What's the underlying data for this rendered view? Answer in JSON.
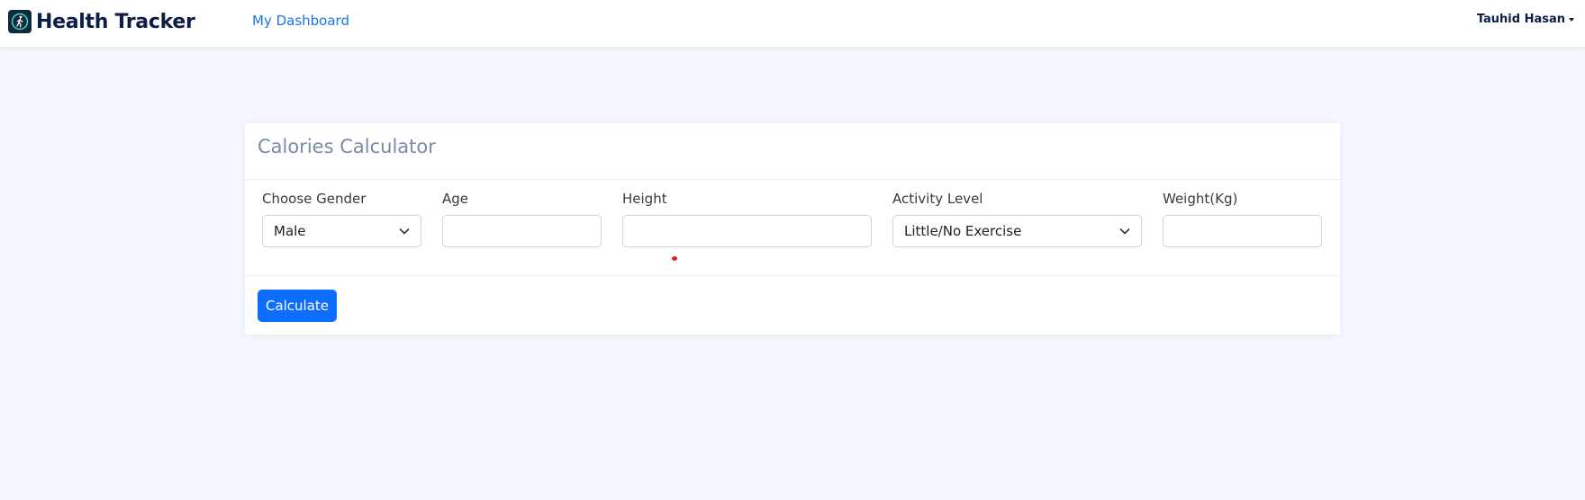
{
  "navbar": {
    "brand": "Health Tracker",
    "brand_icon": "walking-person-icon",
    "link": "My Dashboard",
    "user": "Tauhid Hasan"
  },
  "calculator": {
    "title": "Calories Calculator",
    "gender": {
      "label": "Choose Gender",
      "value": "Male"
    },
    "age": {
      "label": "Age",
      "value": "",
      "placeholder": ""
    },
    "height": {
      "label": "Height",
      "value": "",
      "placeholder": ""
    },
    "activity": {
      "label": "Activity Level",
      "value": "Little/No Exercise"
    },
    "weight": {
      "label": "Weight(Kg)",
      "value": "",
      "placeholder": ""
    },
    "button": "Calculate"
  },
  "colors": {
    "accent": "#0d6efd",
    "link": "#1a73e8",
    "brand_text": "#0c1e45",
    "background": "#f4f7fd"
  }
}
